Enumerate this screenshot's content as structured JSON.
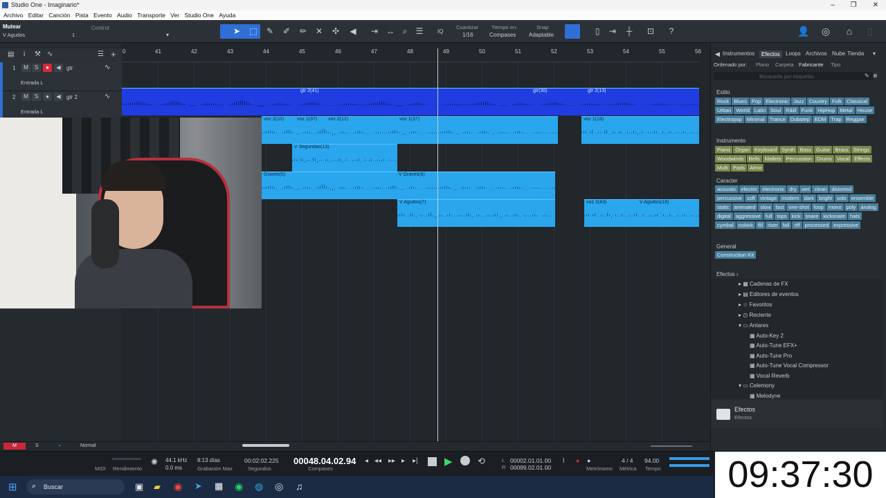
{
  "window": {
    "title": "Studio One - Imaginario*",
    "min": "–",
    "max": "❐",
    "close": "✕"
  },
  "menu": [
    "Archivo",
    "Editar",
    "Canción",
    "Pista",
    "Evento",
    "Audio",
    "Transporte",
    "Ver",
    "Studio One",
    "Ayuda"
  ],
  "inspector": {
    "title": "Mutear",
    "subtitle": "V Agudos",
    "control": "Control",
    "value": "1"
  },
  "toolbar": {
    "quantize_label": "Cuantizar",
    "quantize_value": "1/16",
    "timebase_label": "Tiempo en:",
    "timebase_value": "Compases",
    "snap_label": "Snap",
    "snap_value": "Adaptable",
    "iq": "IQ",
    "help": "?"
  },
  "tracks": [
    {
      "num": "1",
      "name": "gtr",
      "input": "Entrada L",
      "m": "M",
      "s": "S"
    },
    {
      "num": "2",
      "name": "gtr 2",
      "input": "Entrada L",
      "m": "M",
      "s": "S"
    }
  ],
  "ruler": [
    "0",
    "41",
    "42",
    "43",
    "44",
    "45",
    "46",
    "47",
    "48",
    "49",
    "50",
    "51",
    "52",
    "53",
    "54",
    "55",
    "56"
  ],
  "clips": [
    {
      "label": "gtr 2(41)",
      "track": "gtr2a"
    },
    {
      "label": "gtr(30)",
      "track": "gtr2b"
    },
    {
      "label": "gtr 2(13)",
      "track": "gtr2c"
    },
    {
      "label": "voz 2(10)"
    },
    {
      "label": "voz 1(37)"
    },
    {
      "label": "voz 2(12)"
    },
    {
      "label": "voz 1(37)"
    },
    {
      "label": "voz 1(18)"
    },
    {
      "label": "V Segundas(13)"
    },
    {
      "label": "Graves(5)"
    },
    {
      "label": "V Graves(6)"
    },
    {
      "label": "V Agudos(7)"
    },
    {
      "label": "voz 2(43)"
    },
    {
      "label": "V Agudos(18)"
    }
  ],
  "bottombar": {
    "m": "M",
    "s": "S",
    "mode": "Normal"
  },
  "browser": {
    "tabs": [
      "Instrumentos",
      "Efectos",
      "Loops",
      "Archivos",
      "Nube",
      "Tienda"
    ],
    "sort_label": "Ordenado por:",
    "sort_opts": [
      "Plano",
      "Carpeta",
      "Fabricante",
      "Tipo"
    ],
    "search_placeholder": "Búsqueda por etiquetas",
    "estilo_label": "Estilo",
    "estilo": [
      "Rock",
      "Blues",
      "Pop",
      "Electronic",
      "Jazz",
      "Country",
      "Folk",
      "Classical",
      "Urban",
      "World",
      "Latin",
      "Soul",
      "R&B",
      "Funk",
      "HipHop",
      "Metal",
      "House",
      "Electropop",
      "Minimal",
      "Trance",
      "Dubstep",
      "EDM",
      "Trap",
      "Reggae"
    ],
    "instrumento_label": "Instrumento",
    "instrumento": [
      "Piano",
      "Organ",
      "Keyboard",
      "Synth",
      "Bass",
      "Guitar",
      "Brass",
      "Strings",
      "Woodwinds",
      "Bells",
      "Mallets",
      "Percussion",
      "Drums",
      "Vocal",
      "Effects",
      "Multi",
      "Pads",
      "Atmo"
    ],
    "caracter_label": "Caracter",
    "caracter": [
      "acoustic",
      "electric",
      "electronic",
      "dry",
      "wet",
      "clean",
      "distorted",
      "percussive",
      "soft",
      "vintage",
      "modern",
      "dark",
      "bright",
      "solo",
      "ensemble",
      "static",
      "animated",
      "slow",
      "fast",
      "one-shot",
      "loop",
      "mono",
      "poly",
      "analog",
      "digital",
      "aggressive",
      "full",
      "tops",
      "kick",
      "snare",
      "kicksnare",
      "hats",
      "cymbal",
      "nokick",
      "fill",
      "riser",
      "fall",
      "riff",
      "processed",
      "expressive"
    ],
    "general_label": "General",
    "general": [
      "Construction Kit"
    ],
    "efectos_label": "Efectos",
    "tree": [
      "Cadenas de FX",
      "Editores de eventos",
      "Favoritos",
      "Reciente",
      "Antares",
      "Auto-Key 2",
      "Auto-Tune EFX+",
      "Auto-Tune Pro",
      "Auto-Tune Vocal Compressor",
      "Vocal Reverb",
      "Celemony",
      "Melodyne"
    ],
    "footer_title": "Efectos",
    "footer_sub": "Efectos"
  },
  "transport": {
    "midi": "MIDI",
    "rendimiento": "Rendimiento",
    "rate": "44.1 kHz",
    "latency": "0.0 ms",
    "days": "8:13 días",
    "grab": "Grabación Max",
    "seconds": "00:02:02.225",
    "seconds_label": "Segundos",
    "bars": "00048.04.02.94",
    "bars_label": "Compases",
    "l": "L",
    "r": "R",
    "loop_l": "00002.01.01.00",
    "loop_r": "00099.02.01.00",
    "metronome": "Metrónomo",
    "sig": "4 / 4",
    "metrica": "Métrica",
    "tempo": "94.00",
    "tempo_label": "Tempo"
  },
  "clock": "09:37:30",
  "taskbar": {
    "search": "Buscar"
  }
}
